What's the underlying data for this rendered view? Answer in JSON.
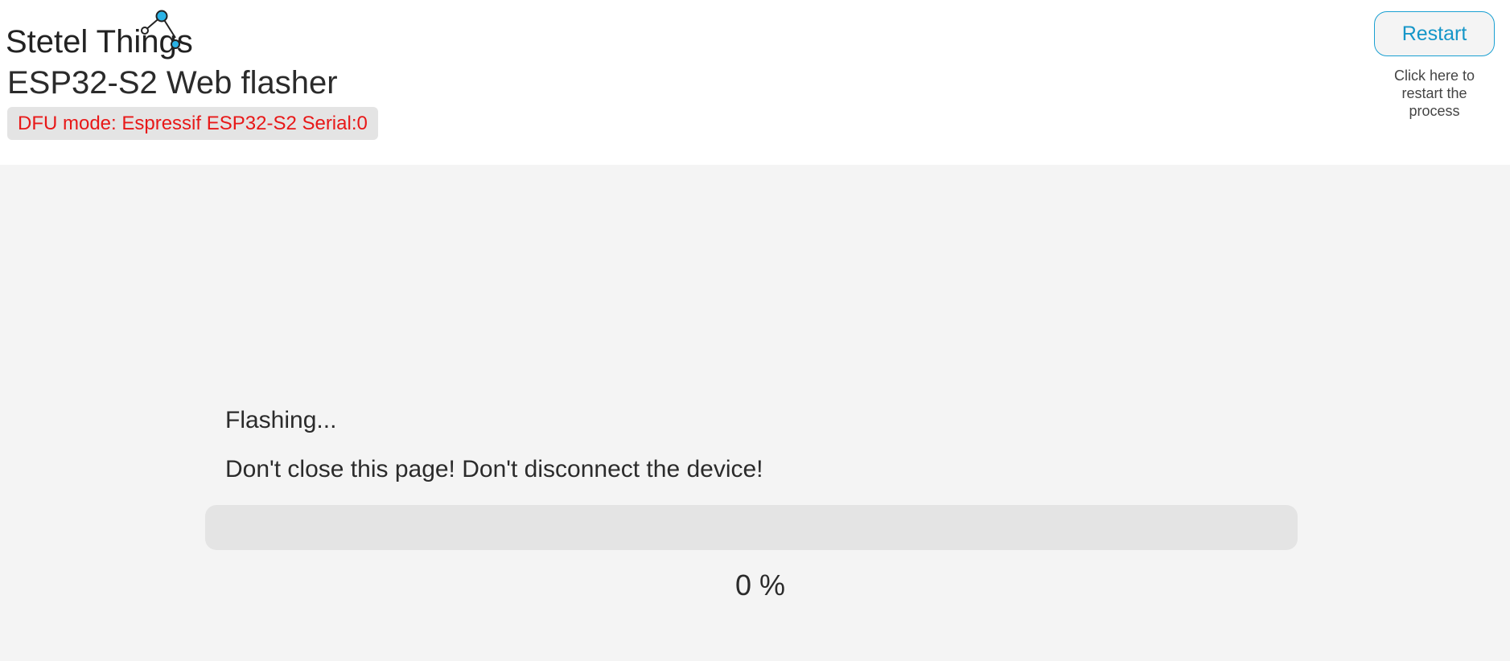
{
  "header": {
    "brand_name": "Stetel Things",
    "app_title": "ESP32-S2 Web flasher",
    "dfu_status": "DFU mode: Espressif ESP32-S2 Serial:0",
    "restart_label": "Restart",
    "restart_hint": "Click here to restart the process"
  },
  "main": {
    "status_title": "Flashing...",
    "warning": "Don't close this page! Don't disconnect the device!",
    "progress_percent": 0,
    "progress_label": "0 %"
  },
  "colors": {
    "accent": "#1aa0d2",
    "status_error": "#e81818",
    "background": "#f4f4f4"
  },
  "icons": {
    "brand_logo": "network-nodes-icon"
  }
}
